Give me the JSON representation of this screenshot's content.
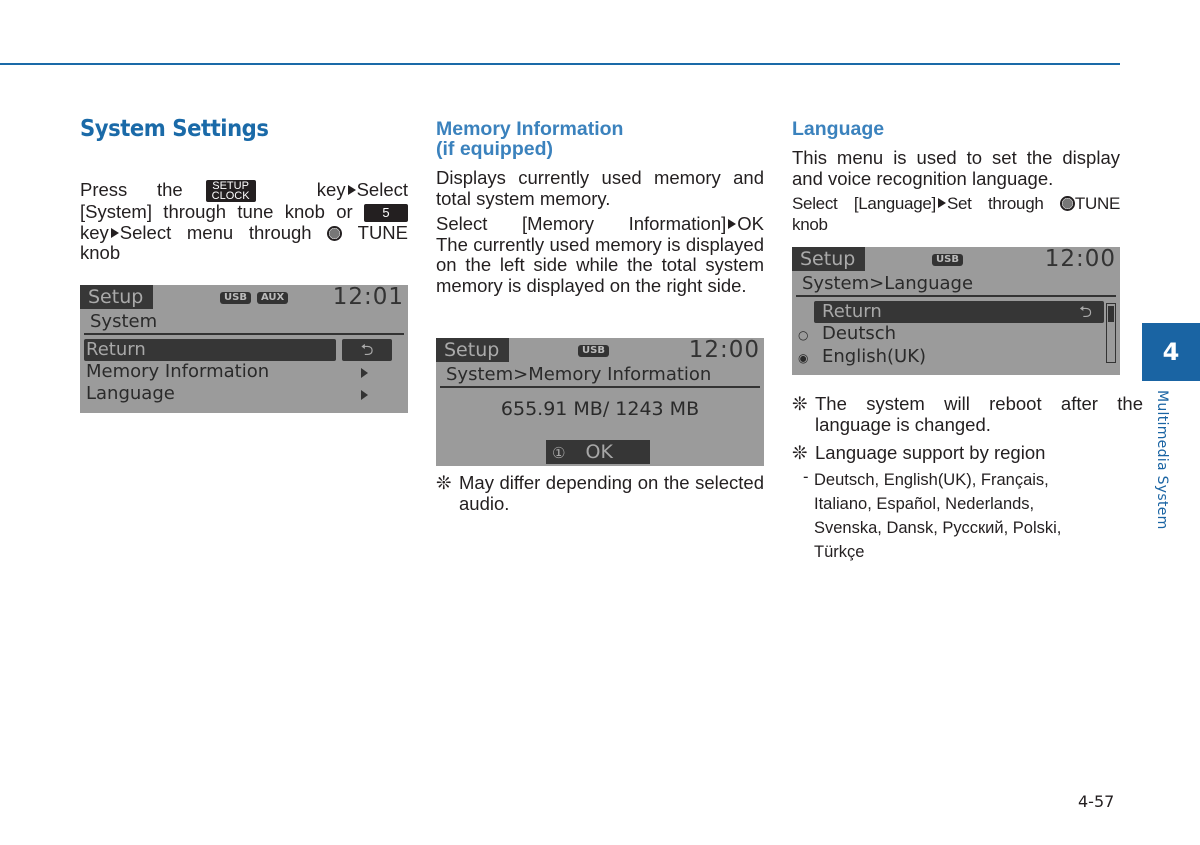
{
  "page": {
    "chapter_number": "4",
    "chapter_label": "Multimedia System",
    "page_number": "4-57",
    "accent_color": "#1a6aa8"
  },
  "col1": {
    "heading": "System Settings",
    "instr": {
      "press": "Press the",
      "key_setup_line1": "SETUP",
      "key_setup_line2": "CLOCK",
      "after_key": "key",
      "select": "Select [System] through tune knob or",
      "key5": "5",
      "key_word": "key",
      "select_menu": "Select menu through",
      "tune": "TUNE knob"
    },
    "screen": {
      "mode": "Setup",
      "badges": [
        "USB",
        "AUX"
      ],
      "clock": "12:01",
      "title": "System",
      "items": [
        {
          "label": "Return",
          "selected": true
        },
        {
          "label": "Memory Information",
          "selected": false
        },
        {
          "label": "Language",
          "selected": false
        }
      ]
    }
  },
  "col2": {
    "heading_line1": "Memory Information",
    "heading_line2": "(if equipped)",
    "para1": "Displays currently used memory and total system memory.",
    "para2_a": "Select [Memory Information]",
    "para2_b": "OK",
    "para2_c": "The currently used memory is displayed on the left side while the total system memory is displayed on the right side.",
    "screen": {
      "mode": "Setup",
      "badges": [
        "USB"
      ],
      "clock": "12:00",
      "title": "System>Memory Information",
      "memory": "655.91 MB/ 1243 MB",
      "ok_number": "①",
      "ok_label": "OK"
    },
    "note": "May differ depending on the selected audio."
  },
  "col3": {
    "heading": "Language",
    "para1": "This menu is used to set the display and voice recognition language.",
    "para2_a": "Select [Language]",
    "para2_b": "Set through",
    "para2_c": "TUNE knob",
    "screen": {
      "mode": "Setup",
      "badges": [
        "USB"
      ],
      "clock": "12:00",
      "title": "System>Language",
      "items": [
        {
          "label": "Return",
          "selected": true,
          "radio": ""
        },
        {
          "label": "Deutsch",
          "selected": false,
          "radio": "○"
        },
        {
          "label": "English(UK)",
          "selected": false,
          "radio": "◉"
        }
      ]
    },
    "note1": "The system will reboot after the language is changed.",
    "note2": "Language support by region",
    "languages": "Deutsch, English(UK), Français, Italiano, Español, Nederlands, Svenska, Dansk, Русский, Polski, Türkçe"
  },
  "icons": {
    "asterisk": "❊",
    "return": "⮌",
    "dash": "-"
  }
}
